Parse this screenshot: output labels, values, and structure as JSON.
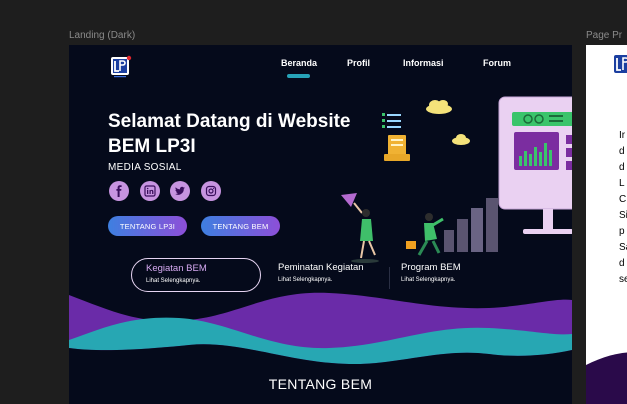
{
  "canvas": {
    "frame_label": "Landing (Dark)",
    "next_frame_label": "Page Pr"
  },
  "nav": {
    "items": [
      {
        "label": "Beranda",
        "active": true
      },
      {
        "label": "Profil"
      },
      {
        "label": "Informasi"
      },
      {
        "label": "Forum"
      }
    ]
  },
  "hero": {
    "title_line1": "Selamat Datang di Website",
    "title_line2": "BEM LP3I",
    "media_label": "MEDIA SOSIAL",
    "social_icons": [
      "facebook-icon",
      "linkedin-icon",
      "twitter-icon",
      "instagram-icon"
    ],
    "buttons": {
      "lp3i": "TENTANG LP3I",
      "bem": "TENTANG BEM"
    }
  },
  "cards": [
    {
      "title": "Kegiatan BEM",
      "subtitle": "Lihat Selengkapnya.",
      "active": true
    },
    {
      "title": "Peminatan Kegiatan",
      "subtitle": "Lihat Selengkapnya."
    },
    {
      "title": "Program BEM",
      "subtitle": "Lihat Selengkapnya."
    }
  ],
  "about": {
    "title": "TENTANG BEM"
  },
  "next_frame": {
    "text_lines": [
      "Ir",
      "d",
      "d",
      "L",
      "C",
      "Si",
      "p",
      "Sa",
      "d",
      "se"
    ]
  },
  "colors": {
    "frame_bg": "#050a1b",
    "accent_teal": "#27a3b8",
    "wave_purple": "#6a2ba8",
    "wave_teal": "#27a7b3",
    "social_bg": "#c794e0",
    "card_active_text": "#d6aaf2",
    "button_gradient_start": "#3e7fe0",
    "button_gradient_end": "#8d4fd8"
  }
}
